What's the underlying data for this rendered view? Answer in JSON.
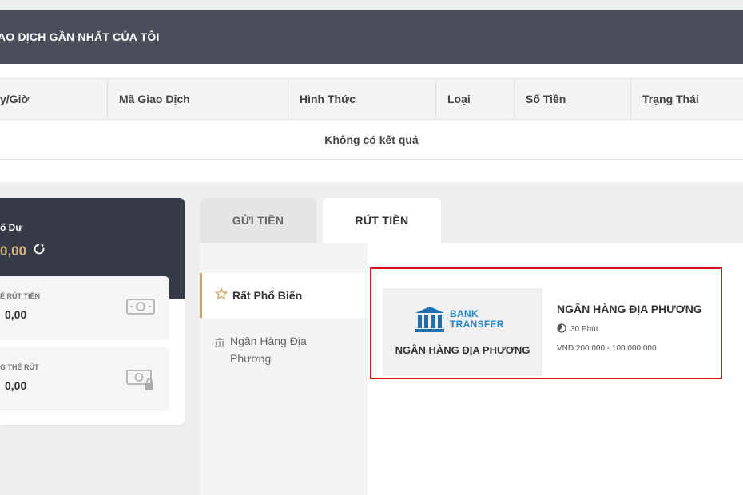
{
  "transactions": {
    "title": "AO DỊCH GẦN NHẤT CỦA TÔI",
    "columns": [
      "y/Giờ",
      "Mã Giao Dịch",
      "Hình Thức",
      "Loại",
      "Số Tiền",
      "Trạng Thái"
    ],
    "empty_text": "Không có kết quả"
  },
  "balance": {
    "label": "ố Dư",
    "value": "0,00",
    "withdrawable_label": "Ể RÚT TIỀN",
    "withdrawable_value": "0,00",
    "not_withdrawable_label": "G THỂ RÚT",
    "not_withdrawable_value": "0,00"
  },
  "tabs": {
    "deposit": "GỬI TIỀN",
    "withdraw": "RÚT TIỀN"
  },
  "categories": {
    "popular": "Rất Phổ Biến",
    "local_bank": "Ngân Hàng Địa Phương"
  },
  "method": {
    "logo_line1": "BANK",
    "logo_line2": "TRANSFER",
    "caption": "NGÂN HÀNG ĐỊA PHƯƠNG",
    "title": "NGÂN HÀNG ĐỊA PHƯƠNG",
    "time": "30 Phút",
    "range": "VND 200.000 - 100.000.000"
  },
  "colors": {
    "header_bg": "#4a4e5a",
    "balance_bg": "#363a46",
    "gold": "#d8b36a",
    "highlight": "#e0141e",
    "bank_blue": "#2b86c8"
  }
}
